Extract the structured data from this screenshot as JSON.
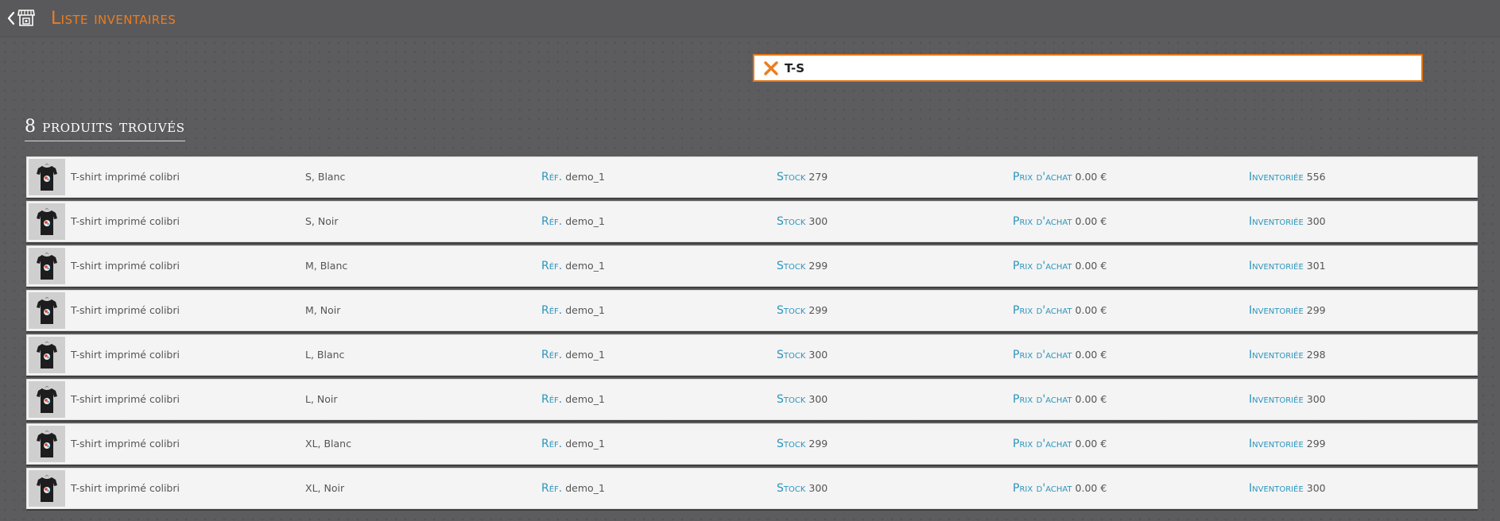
{
  "header": {
    "title": "Liste inventaires",
    "back_icon": "chevron-left-icon",
    "store_icon": "store-icon",
    "title_color": "#ec7d1f"
  },
  "search": {
    "value": "T-S",
    "clear_icon": "close-icon",
    "border_color": "#e67716"
  },
  "results": {
    "count_label": "8 produits trouvés"
  },
  "labels": {
    "ref": "Réf.",
    "stock": "Stock",
    "price": "Prix d'achat",
    "inventoried": "Inventoriée",
    "label_color": "#2b95bd"
  },
  "products": [
    {
      "name": "T-shirt imprimé colibri",
      "variant": "S, Blanc",
      "ref": "demo_1",
      "stock": "279",
      "price": "0.00 €",
      "inventoried": "556"
    },
    {
      "name": "T-shirt imprimé colibri",
      "variant": "S, Noir",
      "ref": "demo_1",
      "stock": "300",
      "price": "0.00 €",
      "inventoried": "300"
    },
    {
      "name": "T-shirt imprimé colibri",
      "variant": "M, Blanc",
      "ref": "demo_1",
      "stock": "299",
      "price": "0.00 €",
      "inventoried": "301"
    },
    {
      "name": "T-shirt imprimé colibri",
      "variant": "M, Noir",
      "ref": "demo_1",
      "stock": "299",
      "price": "0.00 €",
      "inventoried": "299"
    },
    {
      "name": "T-shirt imprimé colibri",
      "variant": "L, Blanc",
      "ref": "demo_1",
      "stock": "300",
      "price": "0.00 €",
      "inventoried": "298"
    },
    {
      "name": "T-shirt imprimé colibri",
      "variant": "L, Noir",
      "ref": "demo_1",
      "stock": "300",
      "price": "0.00 €",
      "inventoried": "300"
    },
    {
      "name": "T-shirt imprimé colibri",
      "variant": "XL, Blanc",
      "ref": "demo_1",
      "stock": "299",
      "price": "0.00 €",
      "inventoried": "299"
    },
    {
      "name": "T-shirt imprimé colibri",
      "variant": "XL, Noir",
      "ref": "demo_1",
      "stock": "300",
      "price": "0.00 €",
      "inventoried": "300"
    }
  ]
}
